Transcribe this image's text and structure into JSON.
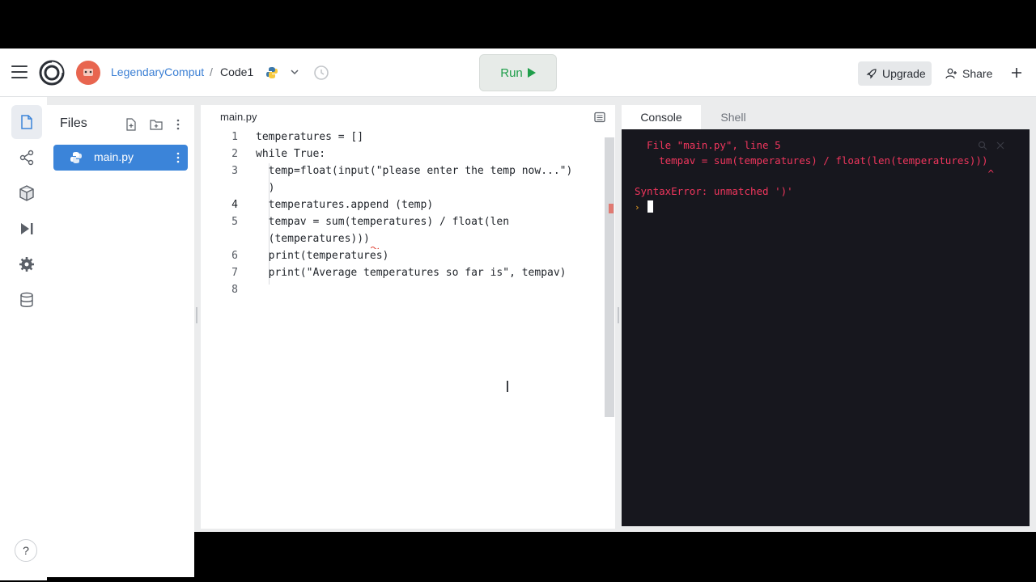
{
  "header": {
    "user": "LegendaryComput",
    "separator": "/",
    "repl_name": "Code1",
    "run_label": "Run",
    "upgrade_label": "Upgrade",
    "share_label": "Share"
  },
  "rail": {
    "icons": [
      "files-icon",
      "git-icon",
      "packages-icon",
      "debugger-icon",
      "settings-icon",
      "database-icon"
    ],
    "help_label": "?"
  },
  "files": {
    "title": "Files",
    "items": [
      {
        "name": "main.py",
        "icon": "python-icon"
      }
    ]
  },
  "editor": {
    "tab_label": "main.py",
    "lines": [
      {
        "num": "1",
        "code": "temperatures = []"
      },
      {
        "num": "2",
        "code": "while True:"
      },
      {
        "num": "3",
        "code": "  temp=float(input(\"please enter the temp now...\")"
      },
      {
        "num": "",
        "code": "  )"
      },
      {
        "num": "4",
        "code": "  temperatures.append (temp)"
      },
      {
        "num": "5",
        "code": "  tempav = sum(temperatures) / float(len"
      },
      {
        "num": "",
        "code": "  (temperatures)))"
      },
      {
        "num": "6",
        "code": "  print(temperatures)"
      },
      {
        "num": "7",
        "code": "  print(\"Average temperatures so far is\", tempav)"
      },
      {
        "num": "8",
        "code": ""
      }
    ],
    "current_line": "4"
  },
  "console": {
    "tabs": [
      "Console",
      "Shell"
    ],
    "active_tab": "Console",
    "output": [
      "  File \"main.py\", line 5",
      "    tempav = sum(temperatures) / float(len(temperatures)))",
      "                                                          ^",
      "SyntaxError: unmatched ')'"
    ],
    "prompt_symbol": "›"
  },
  "colors": {
    "accent_blue": "#3b84d9",
    "run_green": "#1f9e4a",
    "console_bg": "#17171e",
    "error_red": "#f0365d"
  }
}
